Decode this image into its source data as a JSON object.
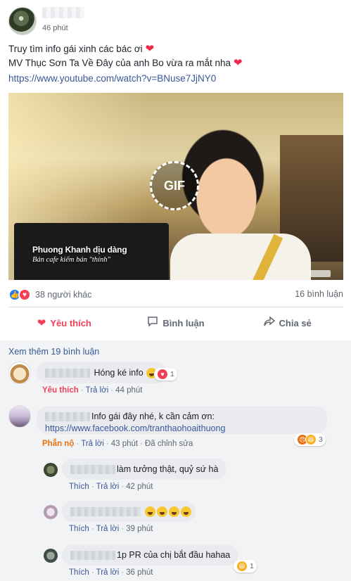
{
  "post": {
    "timestamp": "46 phút",
    "text_line1": "Truy tìm info gái xinh các bác ơi",
    "text_line2": "MV Thục Sơn Ta Về Đây của anh Bo vừa ra mắt nha",
    "heart": "❤",
    "link": "https://www.youtube.com/watch?v=BNuse7JjNY0",
    "media": {
      "badge": "GIF",
      "caption_main": "Phuong Khanh dịu dàng",
      "caption_sub": "Bán cafe kiếm bán \"thính\""
    },
    "reactions": {
      "icons": [
        "like-icon",
        "love-icon"
      ],
      "count_text": "38 người khác"
    },
    "comments_count": "16 bình luận"
  },
  "actions": {
    "like": "Yêu thích",
    "comment": "Bình luận",
    "share": "Chia sẻ"
  },
  "comments_area": {
    "more": "Xem thêm 19 bình luận",
    "items": [
      {
        "text": "Hóng ké info",
        "reaction_badge": {
          "icon": "love-icon",
          "count": "1"
        },
        "action": "Yêu thích",
        "reply": "Trả lời",
        "time": "44 phút"
      },
      {
        "text": "Info gái đây nhé, k cần cảm ơn:",
        "link": "https://www.facebook.com/tranthaohoaithuong",
        "reaction_badge": {
          "icons": [
            "angry-icon",
            "haha-icon"
          ],
          "count": "3"
        },
        "action": "Phẫn nộ",
        "reply": "Trả lời",
        "time": "43 phút",
        "edited": "Đã chỉnh sửa"
      }
    ],
    "replies": [
      {
        "text": "làm tưởng thật, quỷ sứ hà",
        "like": "Thích",
        "reply": "Trả lời",
        "time": "42 phút"
      },
      {
        "text": "",
        "emojis": [
          "laugh-emoji",
          "laugh-emoji",
          "laugh-emoji",
          "laugh-emoji"
        ],
        "like": "Thích",
        "reply": "Trả lời",
        "time": "39 phút"
      },
      {
        "text": "1p PR của chị bắt đầu hahaa",
        "reaction_badge": {
          "icon": "haha-icon",
          "count": "1"
        },
        "like": "Thích",
        "reply": "Trả lời",
        "time": "36 phút"
      }
    ]
  },
  "colors": {
    "link": "#385898",
    "love": "#f33e58",
    "like": "#2078f4",
    "angry": "#e9710f",
    "comment_bg": "#f2f3f5",
    "bubble_bg": "#e9ebee"
  }
}
